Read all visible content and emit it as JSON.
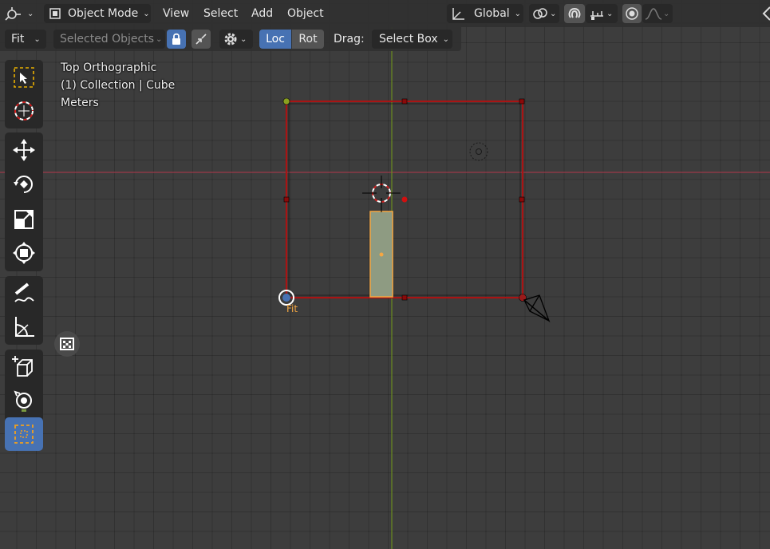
{
  "header": {
    "editor_type_icon": "viewport-editor-icon",
    "mode": "Object Mode",
    "menus": [
      "View",
      "Select",
      "Add",
      "Object"
    ],
    "transform_orientation": "Global"
  },
  "tool_settings": {
    "fit": "Fit",
    "selected_objects": "Selected Objects",
    "loc": "Loc",
    "rot": "Rot",
    "drag_label": "Drag:",
    "drag_value": "Select Box"
  },
  "overlay": {
    "view_name": "Top Orthographic",
    "collection": "(1) Collection | Cube",
    "units": "Meters"
  },
  "viewport": {
    "fit_label": "Fit"
  },
  "toolbar": {
    "tools": [
      "select-box",
      "cursor",
      "move",
      "rotate",
      "scale",
      "transform",
      "annotate",
      "measure",
      "add-cube",
      "camera-rig",
      "select-fit"
    ],
    "active_tool": "select-fit"
  },
  "colors": {
    "accent": "#4772b3",
    "frame": "#b01818",
    "x_axis": "#c0404f",
    "y_axis": "#6a8c20",
    "selection": "#f5a742"
  }
}
